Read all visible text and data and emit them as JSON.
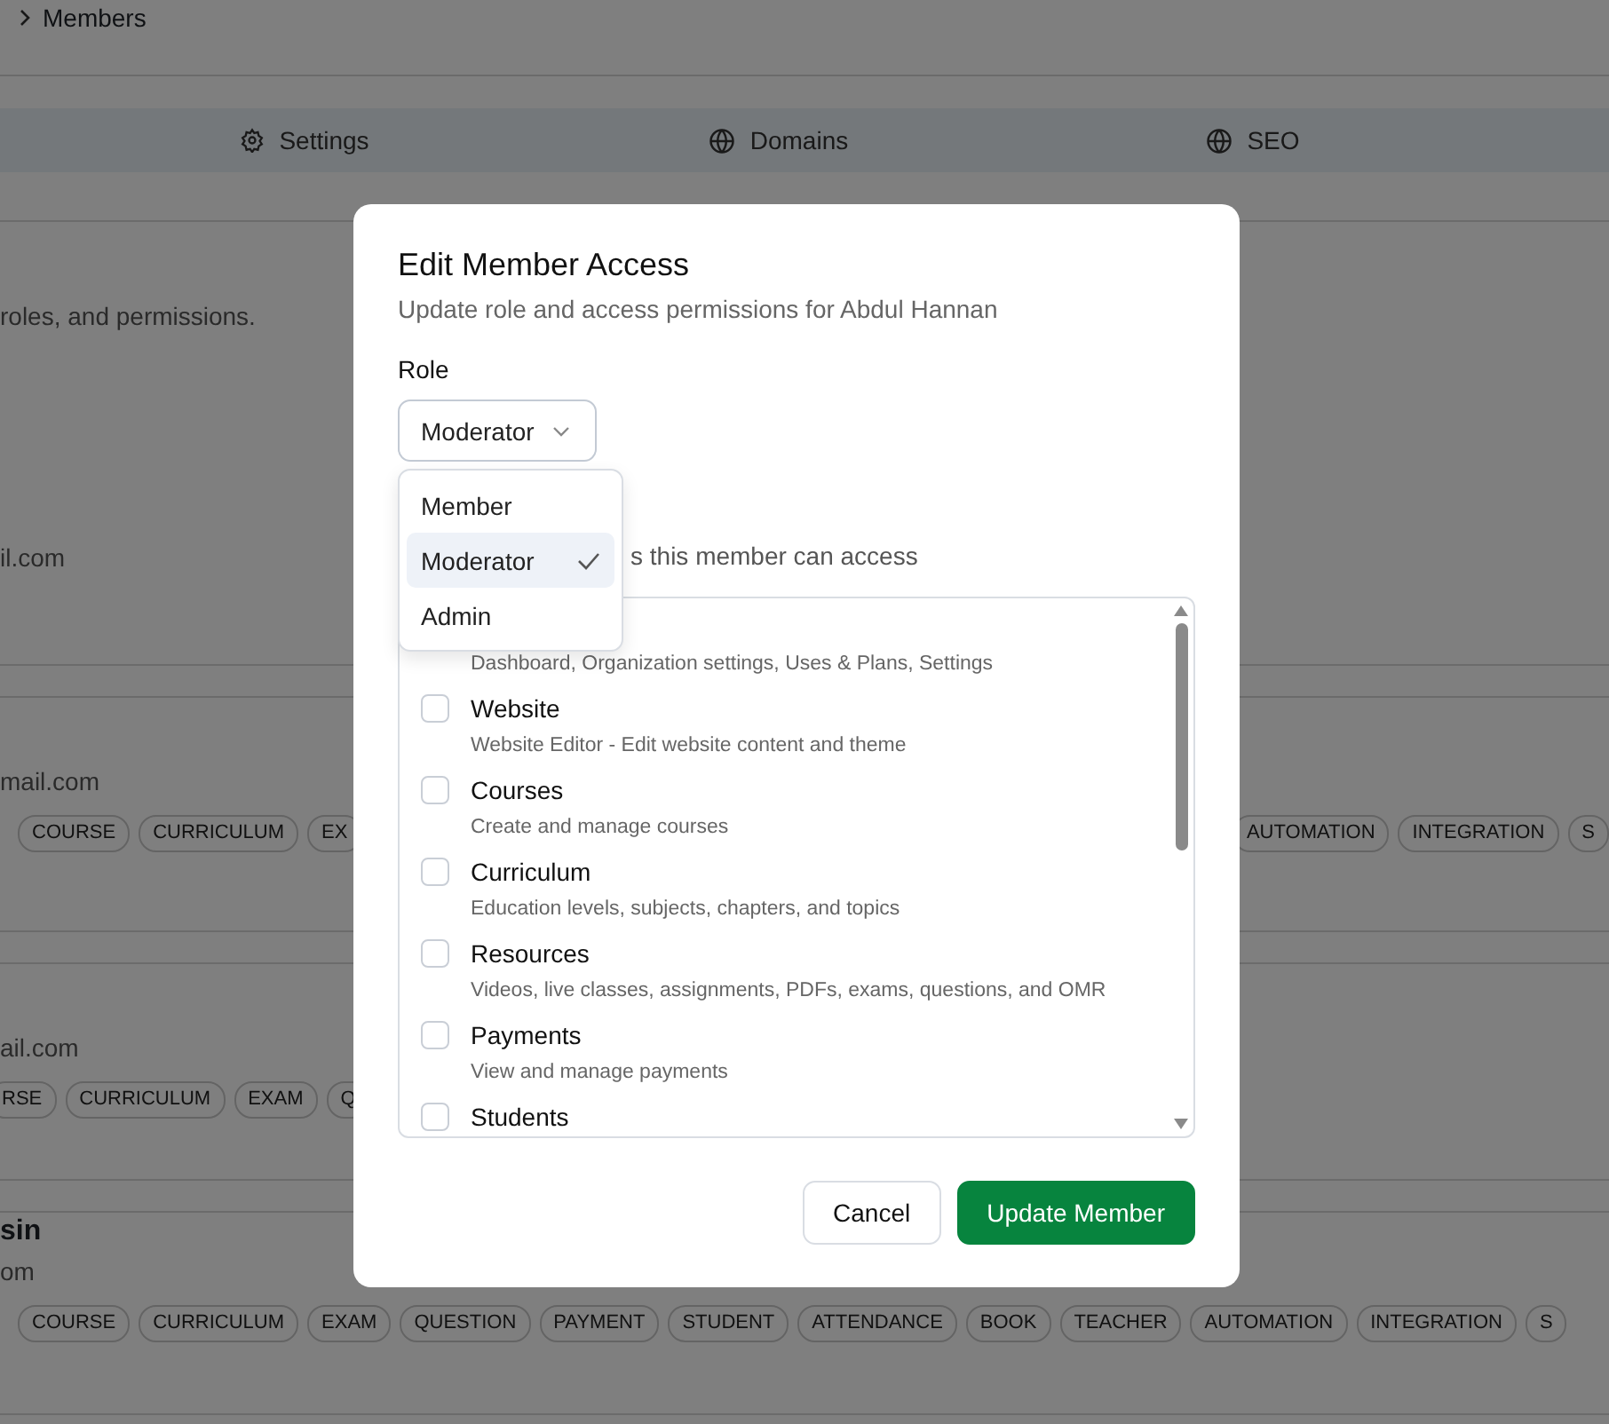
{
  "breadcrumb": {
    "label": "Members"
  },
  "tabs": [
    {
      "label": "Settings",
      "selected": false
    },
    {
      "label": "Domains",
      "selected": false
    },
    {
      "label": "SEO",
      "selected": false
    }
  ],
  "header": {
    "description": "roles, and permissions."
  },
  "members": [
    {
      "email": "il.com"
    },
    {
      "email": "mail.com",
      "tags_left": [
        "COURSE",
        "CURRICULUM",
        "EX"
      ],
      "tags_right": [
        "AUTOMATION",
        "INTEGRATION",
        "S"
      ]
    },
    {
      "email": "ail.com",
      "tags_left": [
        "RSE",
        "CURRICULUM",
        "EXAM",
        "Q"
      ]
    },
    {
      "name": "sin",
      "email": "om",
      "tags_left": [
        "COURSE",
        "CURRICULUM",
        "EXAM",
        "QUESTION",
        "PAYMENT",
        "STUDENT",
        "ATTENDANCE",
        "BOOK",
        "TEACHER",
        "AUTOMATION",
        "INTEGRATION",
        "S"
      ]
    }
  ],
  "dialog": {
    "title": "Edit Member Access",
    "subtitle": "Update role and access permissions for Abdul Hannan",
    "role": {
      "label": "Role",
      "value": "Moderator",
      "open": true,
      "options": [
        {
          "label": "Member",
          "selected": false
        },
        {
          "label": "Moderator",
          "selected": true
        },
        {
          "label": "Admin",
          "selected": false
        }
      ]
    },
    "permissions_hint": "s this member can access",
    "permissions": [
      {
        "description": "Dashboard, Organization settings, Uses & Plans, Settings"
      },
      {
        "title": "Website",
        "description": "Website Editor - Edit website content and theme",
        "checked": false
      },
      {
        "title": "Courses",
        "description": "Create and manage courses",
        "checked": false
      },
      {
        "title": "Curriculum",
        "description": "Education levels, subjects, chapters, and topics",
        "checked": false
      },
      {
        "title": "Resources",
        "description": "Videos, live classes, assignments, PDFs, exams, questions, and OMR",
        "checked": false
      },
      {
        "title": "Payments",
        "description": "View and manage payments",
        "checked": false
      },
      {
        "title": "Students",
        "checked": false
      }
    ],
    "buttons": [
      {
        "label": "Cancel",
        "kind": "secondary"
      },
      {
        "label": "Update Member",
        "kind": "primary"
      }
    ]
  }
}
